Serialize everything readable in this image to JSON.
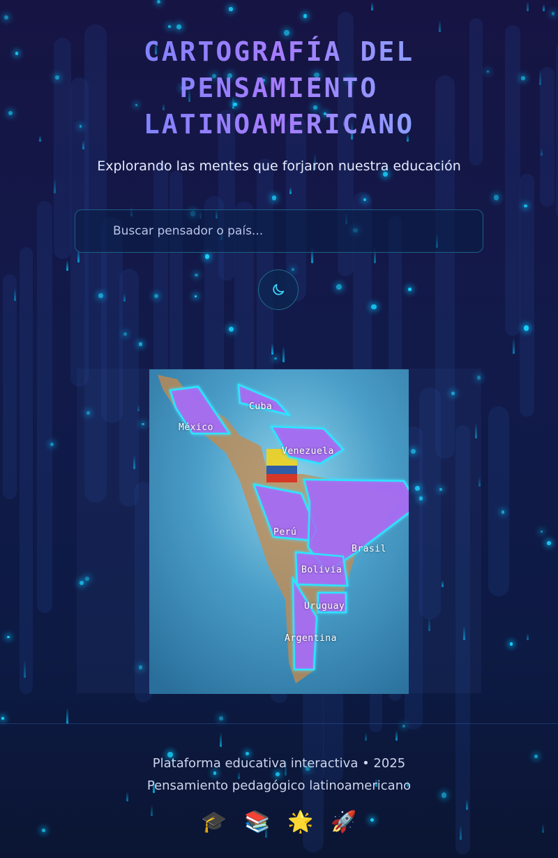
{
  "header": {
    "title_line1": "CARTOGRAFÍA DEL",
    "title_line2": "PENSAMIENTO",
    "title_line3": "LATINOAMERICANO",
    "subtitle": "Explorando las mentes que forjaron nuestra educación"
  },
  "search": {
    "placeholder": "Buscar pensador o país..."
  },
  "theme_toggle": {
    "icon": "moon-icon"
  },
  "map": {
    "countries": [
      "México",
      "Cuba",
      "Venezuela",
      "Perú",
      "Brasil",
      "Bolivia",
      "Uruguay",
      "Argentina"
    ],
    "highlight_color": "#a46cf0",
    "outline_color": "#29e6ff"
  },
  "footer": {
    "line1": "Plataforma educativa interactiva • 2025",
    "line2": "Pensamiento pedagógico latinoamericano",
    "icons": [
      "🎓",
      "📚",
      "🌟",
      "🚀"
    ]
  },
  "colors": {
    "accent": "#19d4ff",
    "title_gradient_start": "#5b8cff",
    "title_gradient_end": "#a67cff"
  }
}
